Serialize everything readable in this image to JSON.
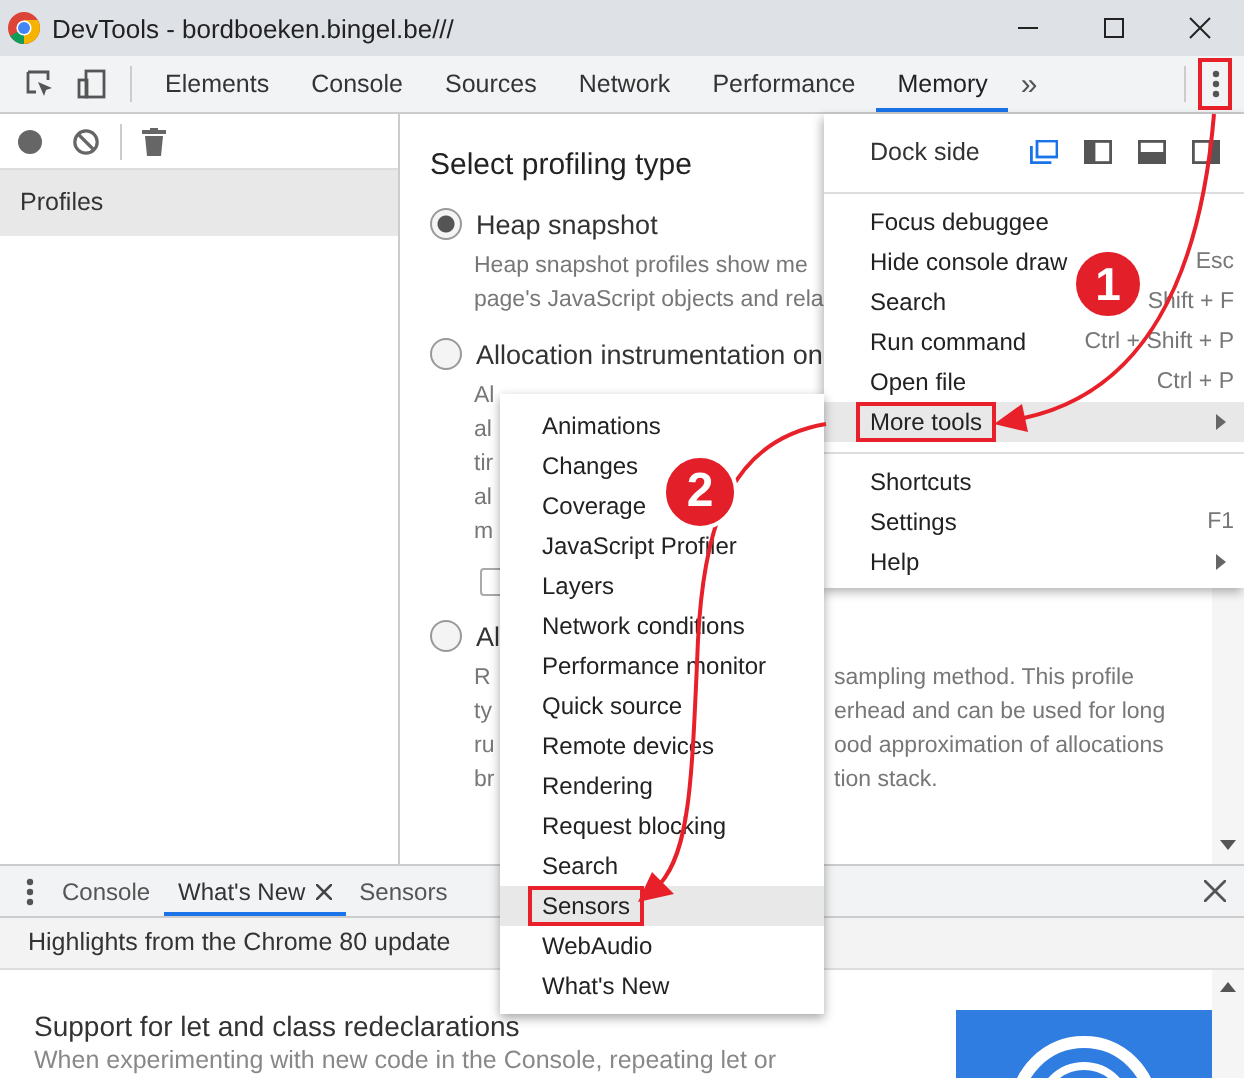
{
  "window": {
    "title": "DevTools - bordboeken.bingel.be///"
  },
  "toolbar": {
    "tabs": [
      {
        "label": "Elements",
        "selected": false
      },
      {
        "label": "Console",
        "selected": false
      },
      {
        "label": "Sources",
        "selected": false
      },
      {
        "label": "Network",
        "selected": false
      },
      {
        "label": "Performance",
        "selected": false
      },
      {
        "label": "Memory",
        "selected": true
      }
    ],
    "overflow": "»",
    "menu_button": {
      "outlined": true
    }
  },
  "sidebar": {
    "items": [
      {
        "label": "Profiles",
        "selected": true
      }
    ]
  },
  "profiling": {
    "heading": "Select profiling type",
    "options": [
      {
        "label": "Heap snapshot",
        "selected": true,
        "lines": [
          {
            "left": "Heap snapshot profiles show me"
          },
          {
            "left": "page's JavaScript objects and rela"
          }
        ]
      },
      {
        "label": "Allocation instrumentation on",
        "selected": false,
        "lines": [
          {
            "left": "Al"
          },
          {
            "left": "al"
          },
          {
            "left": "tir"
          },
          {
            "left": "al"
          },
          {
            "left": "m"
          }
        ],
        "checkbox": {
          "checked": false
        }
      },
      {
        "label": "Al",
        "selected": false,
        "lines": [
          {
            "left": "R",
            "right": "sampling method. This profile"
          },
          {
            "left": "ty",
            "right": "erhead and can be used for long"
          },
          {
            "left": "ru",
            "right": "ood approximation of allocations"
          },
          {
            "left": "br",
            "right": "tion stack."
          }
        ]
      }
    ]
  },
  "main_menu": {
    "dock_side": {
      "label": "Dock side",
      "options": [
        {
          "kind": "undocked",
          "selected": true
        },
        {
          "kind": "left",
          "selected": false
        },
        {
          "kind": "bottom",
          "selected": false
        },
        {
          "kind": "right",
          "selected": false
        }
      ]
    },
    "groups": [
      [
        {
          "label": "Focus debuggee",
          "highlighted": false,
          "outlined": false,
          "submenu": false
        },
        {
          "label": "Hide console draw",
          "shortcut": "Esc",
          "highlighted": false,
          "outlined": false,
          "submenu": false
        },
        {
          "label": "Search",
          "shortcut": "Shift + F",
          "highlighted": false,
          "outlined": false,
          "submenu": false
        },
        {
          "label": "Run command",
          "shortcut": "Ctrl + Shift + P",
          "highlighted": false,
          "outlined": false,
          "submenu": false
        },
        {
          "label": "Open file",
          "shortcut": "Ctrl + P",
          "highlighted": false,
          "outlined": false,
          "submenu": false
        },
        {
          "label": "More tools",
          "highlighted": true,
          "outlined": true,
          "submenu": true
        }
      ],
      [
        {
          "label": "Shortcuts",
          "highlighted": false,
          "outlined": false,
          "submenu": false
        },
        {
          "label": "Settings",
          "shortcut": "F1",
          "highlighted": false,
          "outlined": false,
          "submenu": false
        },
        {
          "label": "Help",
          "highlighted": false,
          "outlined": false,
          "submenu": true
        }
      ]
    ]
  },
  "submenu": {
    "items": [
      {
        "label": "Animations",
        "highlighted": false,
        "outlined": false
      },
      {
        "label": "Changes",
        "highlighted": false,
        "outlined": false
      },
      {
        "label": "Coverage",
        "highlighted": false,
        "outlined": false
      },
      {
        "label": "JavaScript Profiler",
        "highlighted": false,
        "outlined": false
      },
      {
        "label": "Layers",
        "highlighted": false,
        "outlined": false
      },
      {
        "label": "Network conditions",
        "highlighted": false,
        "outlined": false
      },
      {
        "label": "Performance monitor",
        "highlighted": false,
        "outlined": false
      },
      {
        "label": "Quick source",
        "highlighted": false,
        "outlined": false
      },
      {
        "label": "Remote devices",
        "highlighted": false,
        "outlined": false
      },
      {
        "label": "Rendering",
        "highlighted": false,
        "outlined": false
      },
      {
        "label": "Request blocking",
        "highlighted": false,
        "outlined": false
      },
      {
        "label": "Search",
        "highlighted": false,
        "outlined": false
      },
      {
        "label": "Sensors",
        "highlighted": true,
        "outlined": true
      },
      {
        "label": "WebAudio",
        "highlighted": false,
        "outlined": false
      },
      {
        "label": "What's New",
        "highlighted": false,
        "outlined": false
      }
    ]
  },
  "drawer": {
    "tabs": [
      {
        "label": "Console",
        "selected": false,
        "closable": false
      },
      {
        "label": "What's New",
        "selected": true,
        "closable": true
      },
      {
        "label": "Sensors",
        "selected": false,
        "closable": false
      }
    ],
    "banner": "Highlights from the Chrome 80 update",
    "article": {
      "title": "Support for let and class redeclarations",
      "text": "When experimenting with new code in the Console, repeating let or"
    }
  },
  "annotations": [
    {
      "number": "1"
    },
    {
      "number": "2"
    }
  ]
}
